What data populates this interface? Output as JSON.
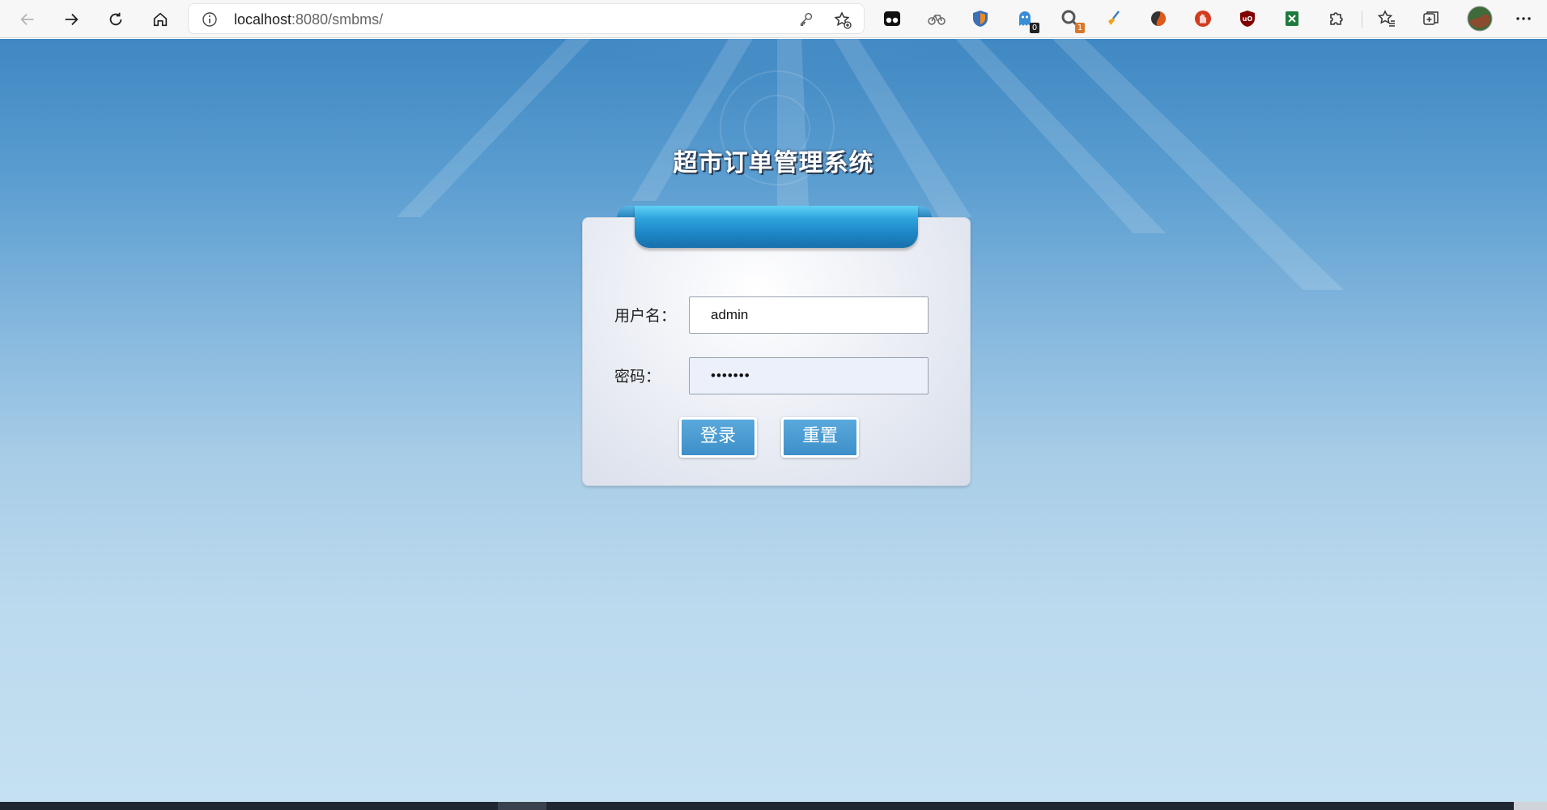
{
  "browser": {
    "url_host": "localhost",
    "url_rest": ":8080/smbms/",
    "extensions": [
      {
        "icon": "tampermonkey-icon",
        "badge": ""
      },
      {
        "icon": "bicycle-icon",
        "badge": ""
      },
      {
        "icon": "shield-fox-icon",
        "badge": ""
      },
      {
        "icon": "ghost-icon",
        "badge": "0"
      },
      {
        "icon": "magnifier-icon",
        "badge": "1"
      },
      {
        "icon": "broom-icon",
        "badge": ""
      },
      {
        "icon": "swirl-icon",
        "badge": ""
      },
      {
        "icon": "hand-stop-icon",
        "badge": ""
      },
      {
        "icon": "ublock-origin-icon",
        "badge": ""
      },
      {
        "icon": "spreadsheet-icon",
        "badge": ""
      },
      {
        "icon": "puzzle-icon",
        "badge": ""
      }
    ]
  },
  "page": {
    "title": "超市订单管理系统",
    "username_label": "用户名：",
    "username_value": "admin",
    "password_label": "密码：",
    "password_value": "•••••••",
    "login_button": "登录",
    "reset_button": "重置"
  },
  "colors": {
    "bg_top": "#3f88c3",
    "bg_bottom": "#c4e0f1",
    "ribbon": "#2ea4de",
    "button": "#4a9bd2"
  }
}
